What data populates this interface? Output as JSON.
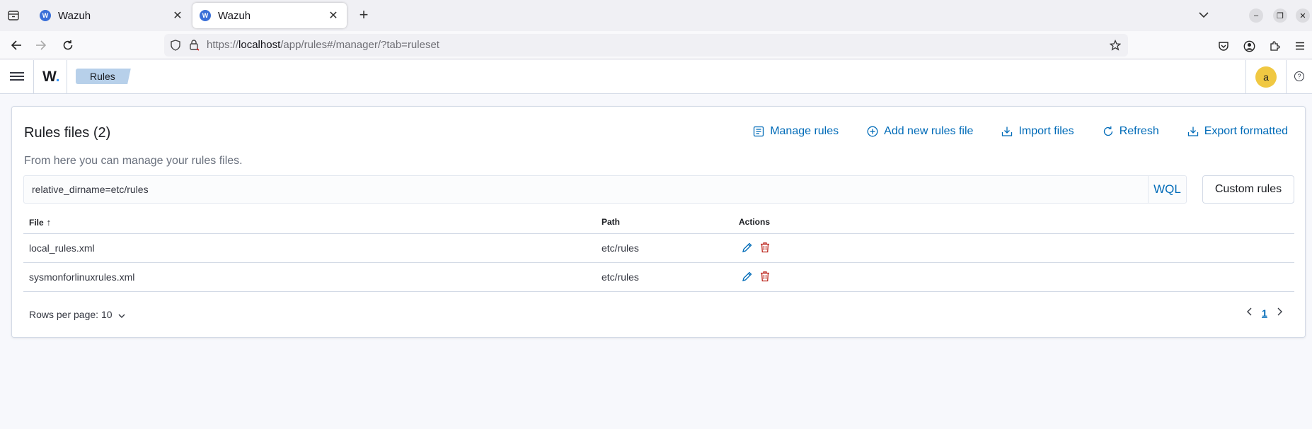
{
  "browser": {
    "tabs": [
      {
        "title": "Wazuh",
        "active": false
      },
      {
        "title": "Wazuh",
        "active": true
      }
    ],
    "url_prefix": "https://",
    "url_host": "localhost",
    "url_path": "/app/rules#/manager/?tab=ruleset"
  },
  "app": {
    "logo_text": "W",
    "logo_dot": ".",
    "breadcrumb": "Rules",
    "avatar_initial": "a",
    "help_glyph": "?"
  },
  "panel": {
    "title": "Rules files (2)",
    "description": "From here you can manage your rules files.",
    "actions": {
      "manage": "Manage rules",
      "add": "Add new rules file",
      "import": "Import files",
      "refresh": "Refresh",
      "export": "Export formatted"
    },
    "search": {
      "value": "relative_dirname=etc/rules",
      "language": "WQL"
    },
    "custom_rules_button": "Custom rules"
  },
  "table": {
    "columns": {
      "file": "File",
      "path": "Path",
      "actions": "Actions"
    },
    "sort_indicator": "↑",
    "rows": [
      {
        "file": "local_rules.xml",
        "path": "etc/rules"
      },
      {
        "file": "sysmonforlinuxrules.xml",
        "path": "etc/rules"
      }
    ]
  },
  "pagination": {
    "rows_per_page_label": "Rows per page: 10",
    "current_page": "1"
  },
  "colors": {
    "link": "#006bb8",
    "danger": "#bd271e",
    "breadcrumb_bg": "#b7d0ea",
    "avatar_bg": "#f0c842"
  }
}
